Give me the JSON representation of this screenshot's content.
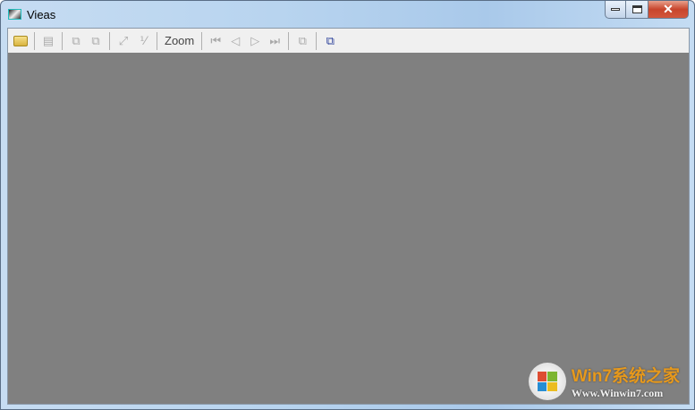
{
  "window": {
    "title": "Vieas"
  },
  "toolbar": {
    "zoom_label": "Zoom"
  },
  "watermark": {
    "line1": "Win7系统之家",
    "line2": "Www.Winwin7.com"
  }
}
